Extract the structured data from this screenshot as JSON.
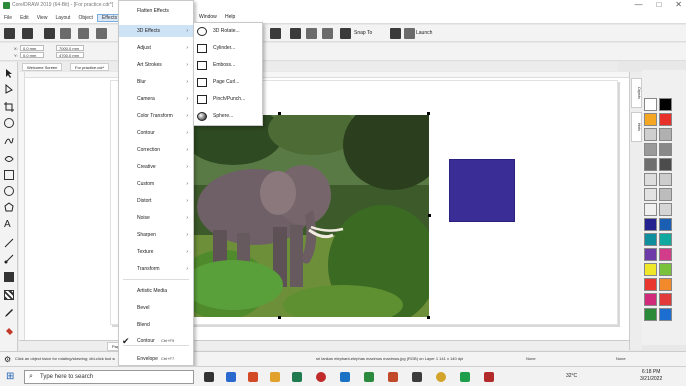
{
  "window": {
    "title": "CorelDRAW 2019 (64-Bit) - [For practice.cdr*]",
    "controls": [
      "—",
      "□",
      "✕"
    ]
  },
  "menubar": [
    "File",
    "Edit",
    "View",
    "Layout",
    "Object",
    "Effects",
    "",
    "",
    "",
    "",
    "",
    "",
    "",
    "",
    "",
    "",
    "",
    "",
    "",
    "",
    "",
    "Window",
    "Help"
  ],
  "toolbar": {
    "snap_label": "Snap To",
    "launch_label": "Launch"
  },
  "propbar": {
    "x": "0.0 mm",
    "y": "0.0 mm",
    "w": "7000.0 mm",
    "h": "4700.0 mm"
  },
  "doc_tabs": [
    "Welcome Screen",
    "For practice.cdr*"
  ],
  "effects_menu": {
    "items": [
      {
        "label": "Flatten Effects",
        "arrow": false
      },
      {
        "label": "3D Effects",
        "arrow": true,
        "highlight": true
      },
      {
        "label": "Adjust",
        "arrow": true
      },
      {
        "label": "Art Strokes",
        "arrow": true
      },
      {
        "label": "Blur",
        "arrow": true
      },
      {
        "label": "Camera",
        "arrow": true
      },
      {
        "label": "Color Transform",
        "arrow": true
      },
      {
        "label": "Contour",
        "arrow": true
      },
      {
        "label": "Correction",
        "arrow": true
      },
      {
        "label": "Creative",
        "arrow": true
      },
      {
        "label": "Custom",
        "arrow": true
      },
      {
        "label": "Distort",
        "arrow": true
      },
      {
        "label": "Noise",
        "arrow": true
      },
      {
        "label": "Sharpen",
        "arrow": true
      },
      {
        "label": "Texture",
        "arrow": true
      },
      {
        "label": "Transform",
        "arrow": true
      },
      {
        "label": "Artistic Media",
        "arrow": false
      },
      {
        "label": "Bevel",
        "arrow": false
      },
      {
        "label": "Blend",
        "arrow": false
      },
      {
        "label": "Contour",
        "shortcut": "Ctrl+F9",
        "checked": true
      },
      {
        "label": "Envelope",
        "shortcut": "Ctrl+F7"
      }
    ]
  },
  "submenu_3d": [
    "3D Rotate...",
    "Cylinder...",
    "Emboss...",
    "Page Curl...",
    "Pinch/Punch...",
    "Sphere..."
  ],
  "page_tab": "Page 1",
  "status": {
    "hint": "Click an object twice for rotating/skewing; dbl-click tool selects all objects; Shift+click multi-selects; Alt+click digs; Ctrl+click selects in a group",
    "object_info": "sri lankan elephant-elephas maximus maximus.jpg (RGB) on Layer 1 141 x 140 dpi",
    "fill_label": "None",
    "outline_label": "None"
  },
  "docker_tabs": [
    "Objects",
    "Hints"
  ],
  "palette_colors": [
    "#ffffff",
    "#000000",
    "#f5a623",
    "#e8302a",
    "#cfcfcf",
    "#b0b0b0",
    "#9a9a9a",
    "#888888",
    "#6e6e6e",
    "#4c4c4c",
    "#dddddd",
    "#cccccc",
    "#e2e2e2",
    "#bcbcbc",
    "#f0f0f0",
    "#d5d5d5",
    "#23228e",
    "#1b5fb4",
    "#0f8f9e",
    "#11a8a0",
    "#6e3aa8",
    "#d23c8a",
    "#f0e62a",
    "#7ac23c",
    "#e9362e",
    "#f2892a",
    "#d22a7a",
    "#e23a3a",
    "#2a8a3a",
    "#1c6fd0"
  ],
  "taskbar": {
    "search_placeholder": "Type here to search",
    "weather": "32°C",
    "time": "6:18 PM",
    "date": "3/21/2022"
  }
}
